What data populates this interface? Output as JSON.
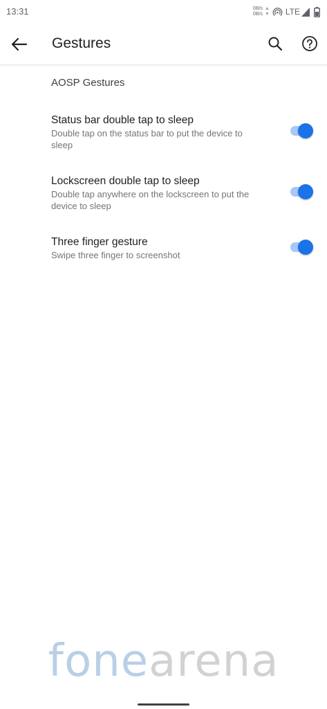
{
  "status_bar": {
    "time": "13:31",
    "net_speed_up": "0B/s",
    "net_speed_down": "0B/s",
    "network_type": "LTE"
  },
  "app_bar": {
    "title": "Gestures"
  },
  "category": {
    "title": "AOSP Gestures"
  },
  "preferences": [
    {
      "title": "Status bar double tap to sleep",
      "summary": "Double tap on the status bar to put the device to sleep",
      "enabled": true
    },
    {
      "title": "Lockscreen double tap to sleep",
      "summary": "Double tap anywhere on the lockscreen to put the device to sleep",
      "enabled": true
    },
    {
      "title": "Three finger gesture",
      "summary": "Swipe three finger to screenshot",
      "enabled": true
    }
  ],
  "watermark": {
    "part1": "fone",
    "part2": "arena"
  },
  "colors": {
    "accent": "#1a73e8",
    "track": "#a8c7fa"
  }
}
